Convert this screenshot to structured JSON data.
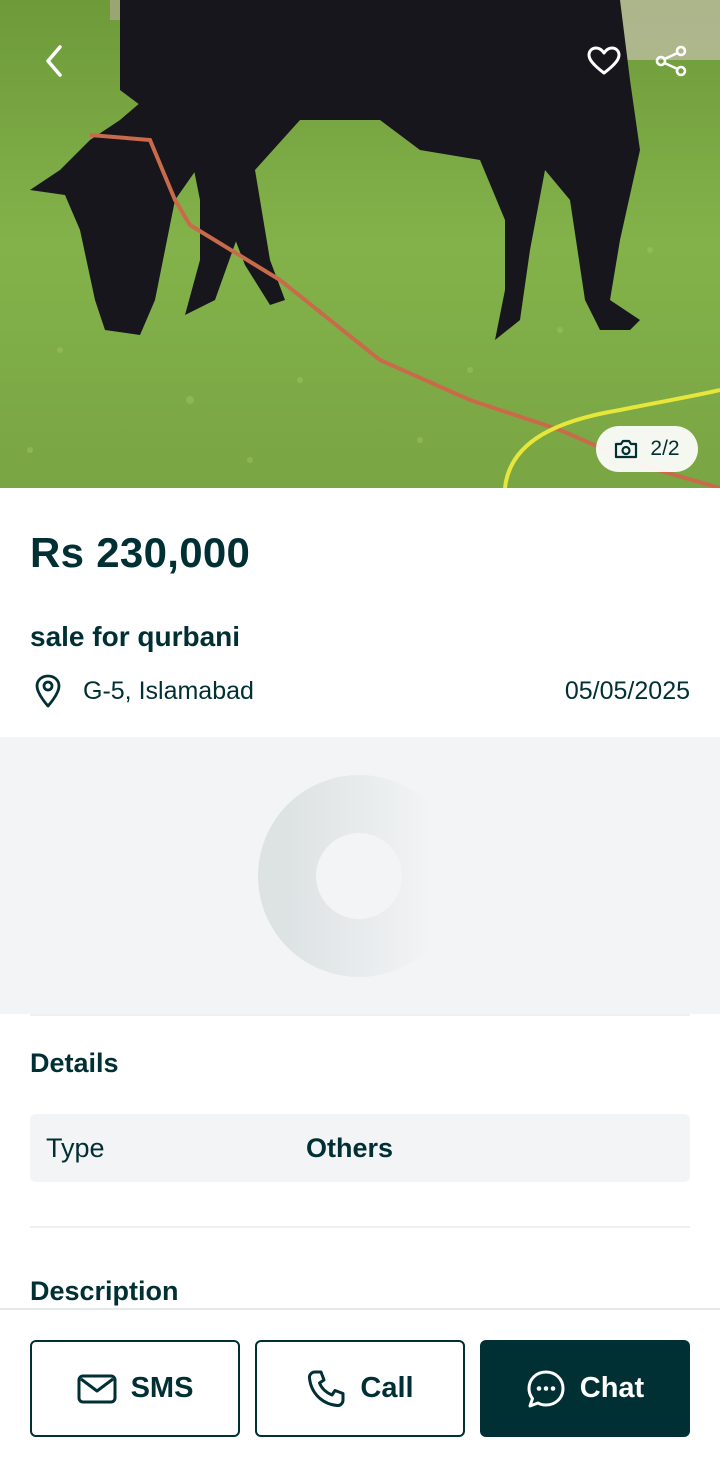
{
  "hero": {
    "image_counter": "2/2",
    "icons": {
      "back": "chevron-left-icon",
      "favorite": "heart-icon",
      "share": "share-icon",
      "camera": "camera-icon"
    }
  },
  "listing": {
    "price": "Rs 230,000",
    "title": "sale for qurbani",
    "location": "G-5, Islamabad",
    "date": "05/05/2025"
  },
  "details": {
    "heading": "Details",
    "rows": [
      {
        "key": "Type",
        "value": "Others"
      }
    ]
  },
  "description": {
    "heading": "Description"
  },
  "actions": {
    "sms_label": "SMS",
    "call_label": "Call",
    "chat_label": "Chat"
  },
  "colors": {
    "primary": "#002f34",
    "surface": "#f2f4f5",
    "white": "#ffffff"
  }
}
